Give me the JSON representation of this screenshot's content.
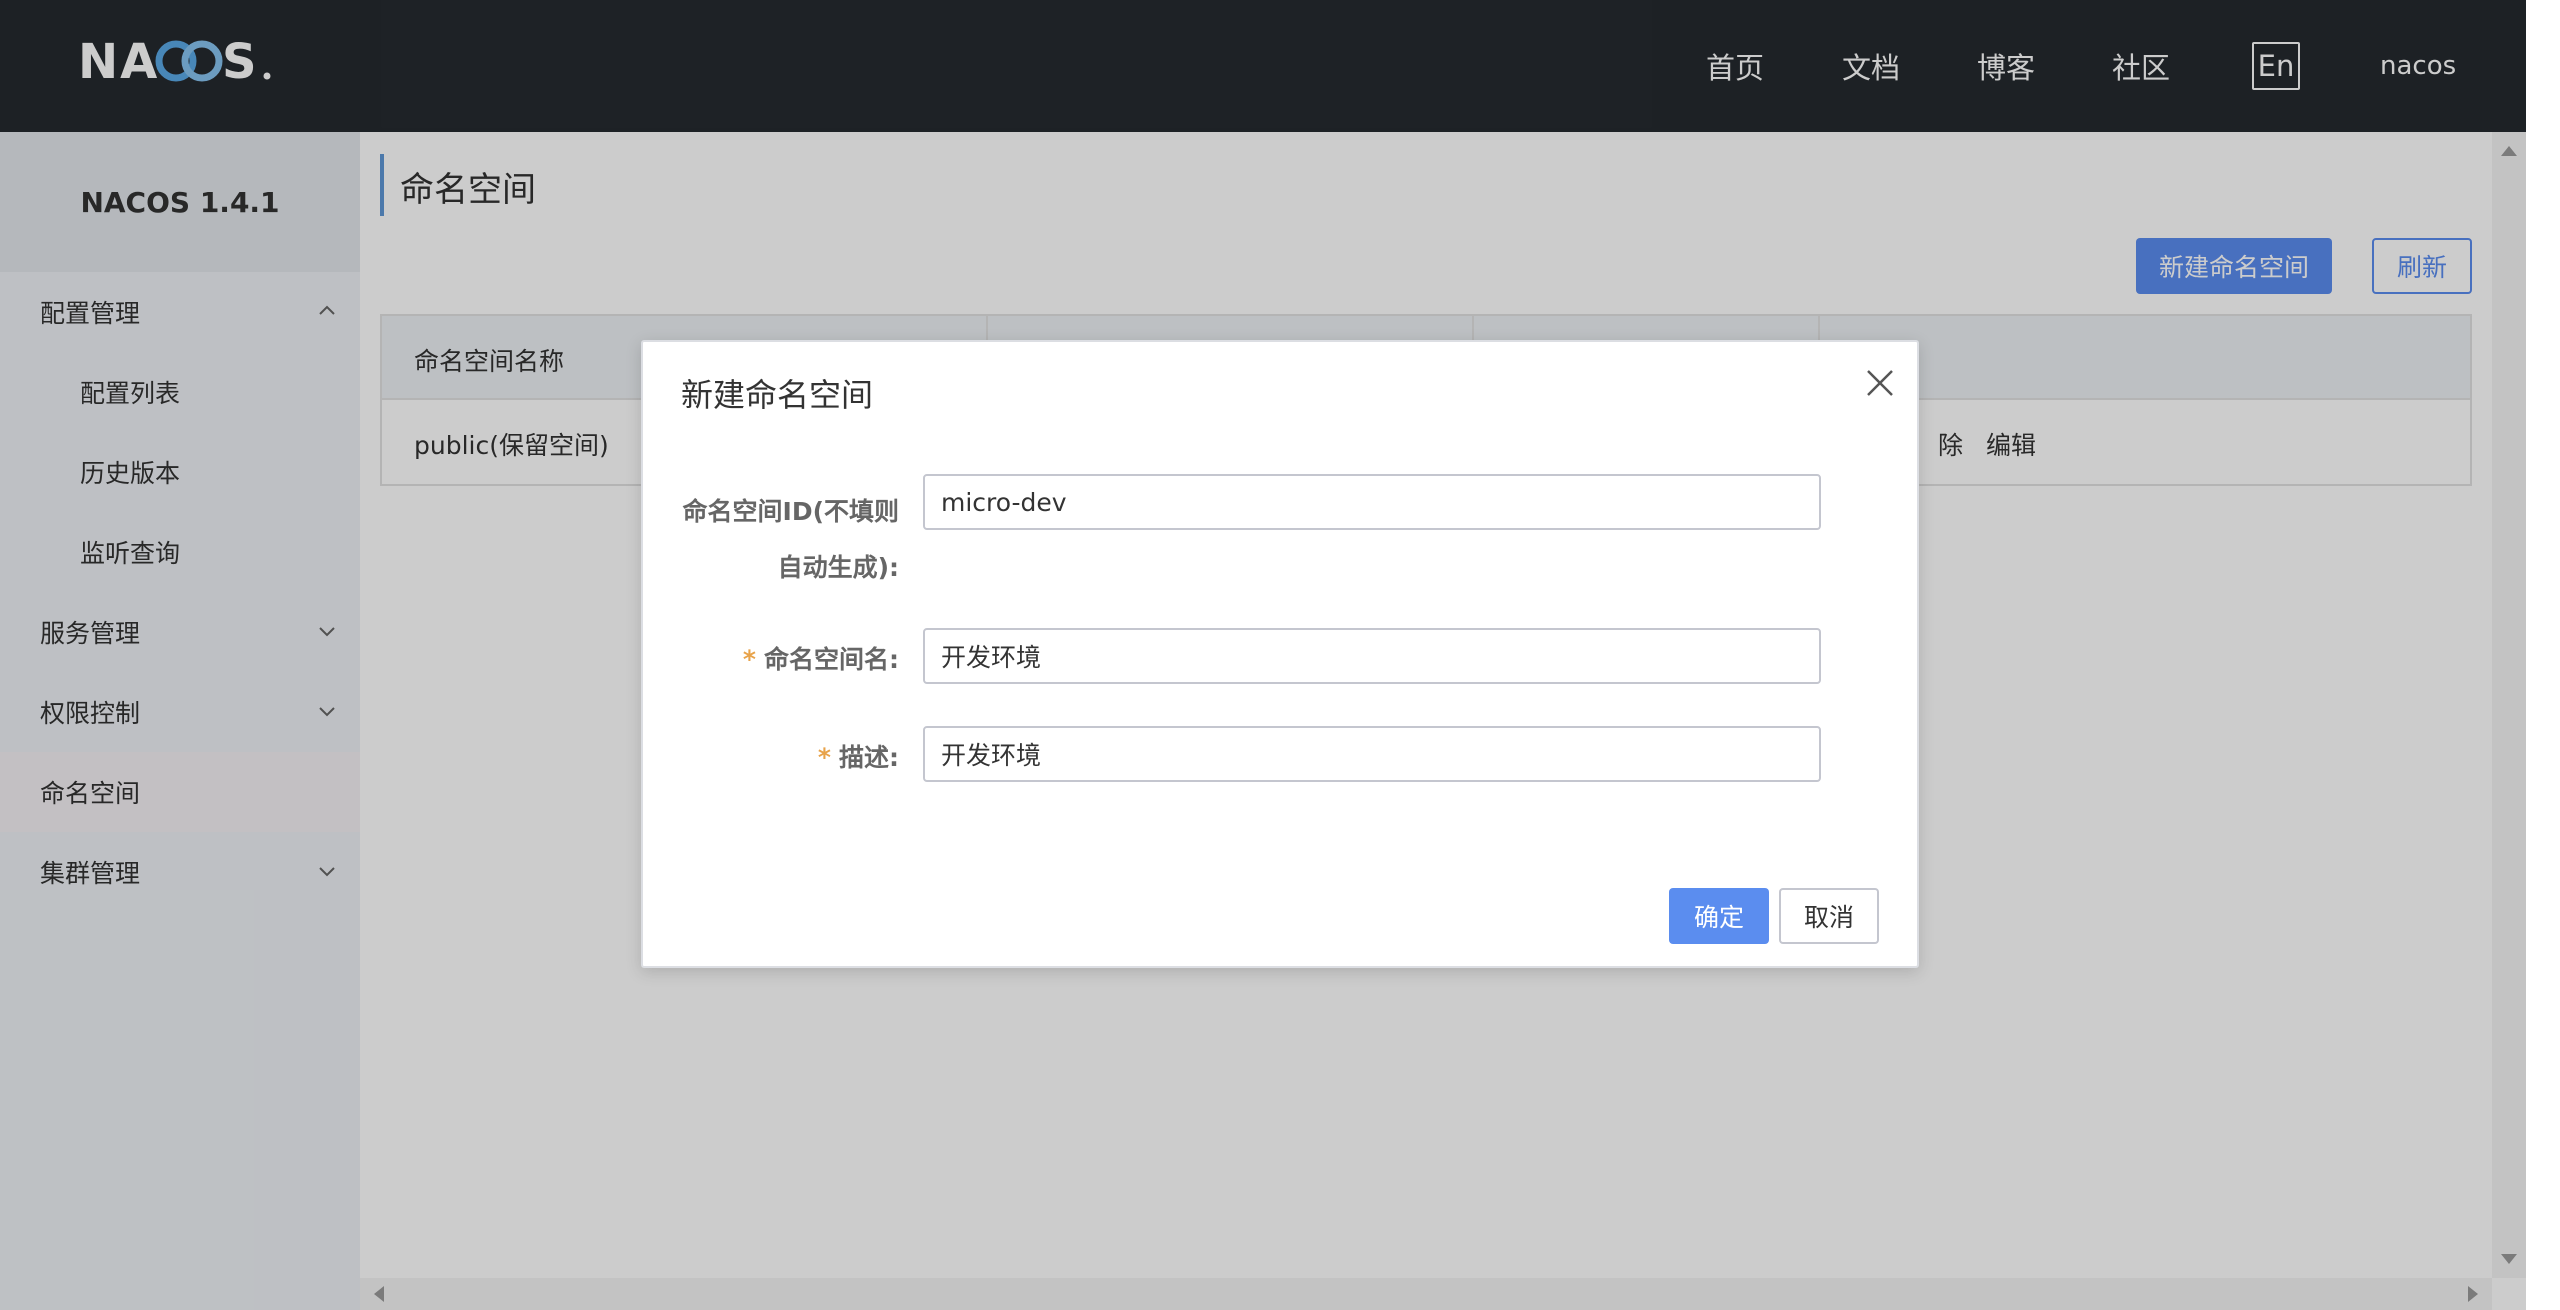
{
  "header": {
    "logo_text": "NACOS.",
    "nav": [
      "首页",
      "文档",
      "博客",
      "社区"
    ],
    "lang_button": "En",
    "user": "nacos"
  },
  "sidebar": {
    "title": "NACOS 1.4.1",
    "items": [
      {
        "label": "配置管理",
        "type": "group",
        "expanded": true
      },
      {
        "label": "配置列表",
        "type": "sub"
      },
      {
        "label": "历史版本",
        "type": "sub"
      },
      {
        "label": "监听查询",
        "type": "sub"
      },
      {
        "label": "服务管理",
        "type": "group",
        "expanded": false
      },
      {
        "label": "权限控制",
        "type": "group",
        "expanded": false
      },
      {
        "label": "命名空间",
        "type": "item",
        "active": true
      },
      {
        "label": "集群管理",
        "type": "group",
        "expanded": false
      }
    ]
  },
  "main": {
    "page_title": "命名空间",
    "new_button": "新建命名空间",
    "refresh_button": "刷新",
    "table": {
      "headers": [
        "命名空间名称",
        "",
        "",
        ""
      ],
      "rows": [
        {
          "name": "public(保留空间)",
          "actions": [
            "除",
            "编辑"
          ]
        }
      ]
    }
  },
  "dialog": {
    "title": "新建命名空间",
    "fields": {
      "id_label_line1": "命名空间ID(不填则",
      "id_label_line2": "自动生成):",
      "id_value": "micro-dev",
      "name_label": "命名空间名:",
      "name_value": "开发环境",
      "desc_label": "描述:",
      "desc_value": "开发环境",
      "required_mark": "*"
    },
    "ok_button": "确定",
    "cancel_button": "取消"
  },
  "colors": {
    "header_bg": "#252a2f",
    "primary": "#5b8def",
    "sidebar_bg": "#eef1f5",
    "required": "#e8a34a"
  }
}
